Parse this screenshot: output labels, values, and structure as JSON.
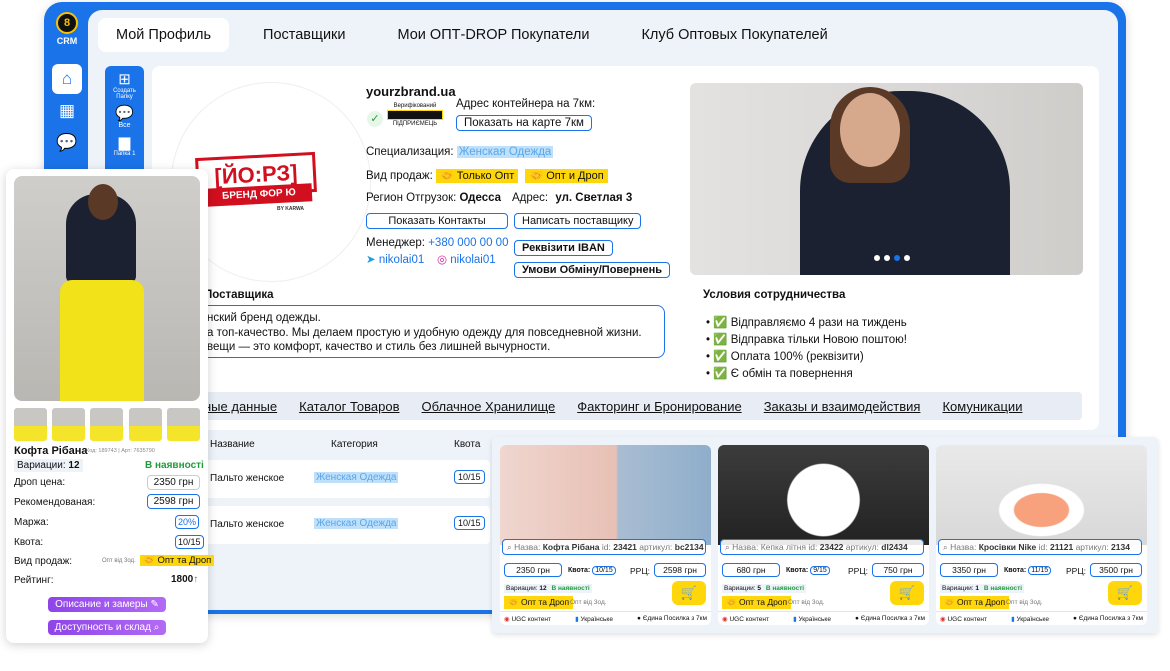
{
  "nav": {
    "crm_label": "CRM",
    "tabs": [
      "Мой Профиль",
      "Поставщики",
      "Мои ОПТ-DROP Покупатели",
      "Клуб Оптовых Покупателей"
    ]
  },
  "inner_rail": {
    "items": [
      "Создать Папку",
      "Все",
      "Папка 1"
    ]
  },
  "brand": {
    "logo_main": "[ЙО:РЗ]",
    "logo_ribbon": "БРЕНД ФОР Ю",
    "logo_by": "BY KARWA"
  },
  "profile": {
    "store_name": "yourzbrand.ua",
    "verified_label": "Верифікований",
    "verified_sub": "ПІДПРИЄМЕЦЬ",
    "container_label": "Адрес контейнера на 7км:",
    "map_button": "Показать на карте 7км",
    "specialization_label": "Специализация:",
    "specialization_value": "Женская Одежда",
    "sale_type_label": "Вид продаж:",
    "sale_type_1": "Только Опт",
    "sale_type_2": "Опт и Дроп",
    "region_label": "Регион Отгрузок:",
    "region_value": "Одесса",
    "address_label": "Адрес:",
    "address_value": "ул. Светлая 3",
    "show_contacts": "Показать Контакты",
    "write_supplier": "Написать поставщику",
    "manager_label": "Менеджер:",
    "manager_phone": "+380 000 00 00",
    "iban_button": "Реквізити IBAN",
    "telegram": "nikolai01",
    "instagram": "nikolai01",
    "exchange_button": "Умови Обміну/Повернень"
  },
  "about": {
    "title": "Поставщика",
    "lines": [
      "нский бренд одежды.",
      "а топ-качество. Мы делаем простую и удобную одежду для повседневной жизни.",
      "вещи — это комфорт, качество и стиль без лишней вычурности."
    ]
  },
  "terms": {
    "title": "Условия сотрудничества",
    "items": [
      "✅ Відправляємо 4 рази на тиждень",
      "✅ Відправка тільки Новою поштою!",
      "✅ Оплата 100% (реквізити)",
      "✅ Є обмін та повернення"
    ]
  },
  "menu": [
    "ные данные",
    "Каталог Товаров",
    "Облачное Хранилище",
    "Факторинг и Бронирование",
    "Заказы и взаимодействия",
    "Комуникации"
  ],
  "table": {
    "headers": [
      "Название",
      "Категория",
      "Квота"
    ],
    "rows": [
      {
        "name": "Пальто женское",
        "category": "Женская Одежда",
        "quota": "10/15"
      },
      {
        "name": "Пальто женское",
        "category": "Женская Одежда",
        "quota": "10/15"
      }
    ]
  },
  "cards": [
    {
      "search_label": "Назва:",
      "name": "Кофта Рібана",
      "id_label": "id:",
      "id": "23421",
      "art_label": "артикул:",
      "art": "bc2134",
      "price": "2350 грн",
      "quota_label": "Квота:",
      "quota": "10/15",
      "rrp_label": "РРЦ:",
      "rrp": "2598 грн",
      "variations_label": "Вариации:",
      "variations": "12",
      "stock": "В наявності",
      "sale_type": "Опт та Дроп",
      "ship": "Опт від 3од.",
      "feat_1": "UGC контент",
      "feat_2": "Українське",
      "feat_3": "Єдина Посилка з 7км"
    },
    {
      "search_label": "Назва:",
      "name": "Кепка літня",
      "id_label": "id:",
      "id": "23422",
      "art_label": "артикул:",
      "art": "dl2434",
      "price": "680 грн",
      "quota_label": "Квота:",
      "quota": "9/15",
      "rrp_label": "РРЦ:",
      "rrp": "750 грн",
      "variations_label": "Вариации:",
      "variations": "5",
      "stock": "В наявності",
      "sale_type": "Опт та Дроп",
      "ship": "Опт від 3од.",
      "feat_1": "UGC контент",
      "feat_2": "Українське",
      "feat_3": "Єдина Посилка з 7км"
    },
    {
      "search_label": "Назва:",
      "name": "Кросівки Nike",
      "id_label": "id:",
      "id": "21121",
      "art_label": "артикул:",
      "art": "2134",
      "price": "3350 грн",
      "quota_label": "Квота:",
      "quota": "11/15",
      "rrp_label": "РРЦ:",
      "rrp": "3500 грн",
      "variations_label": "Вариации:",
      "variations": "1",
      "stock": "В наявності",
      "sale_type": "Опт та Дроп",
      "ship": "Опт від 3од.",
      "feat_1": "UGC контент",
      "feat_2": "Українське",
      "feat_3": "Єдина Посилка з 7км"
    }
  ],
  "product": {
    "name": "Кофта Рібана",
    "code": "Код: 189743 | Арт: 7635790",
    "variations_label": "Вариации:",
    "variations": "12",
    "stock": "В наявності",
    "drop_label": "Дроп цена:",
    "drop_value": "2350 грн",
    "rec_label": "Рекомендованая:",
    "rec_value": "2598 грн",
    "margin_label": "Маржа:",
    "margin_value": "20%",
    "quota_label": "Квота:",
    "quota_value": "10/15",
    "sale_label": "Вид продаж:",
    "sale_note": "Опт від 3од.",
    "sale_value": "Опт та Дроп",
    "rating_label": "Рейтинг:",
    "rating_value": "1800",
    "desc_button": "Описание и замеры",
    "avail_button": "Доступность и склад"
  },
  "colors": {
    "accent": "#1a73e8",
    "yellow": "#ffd60a",
    "purple": "#9b51e0",
    "green": "#1e9e3a"
  }
}
